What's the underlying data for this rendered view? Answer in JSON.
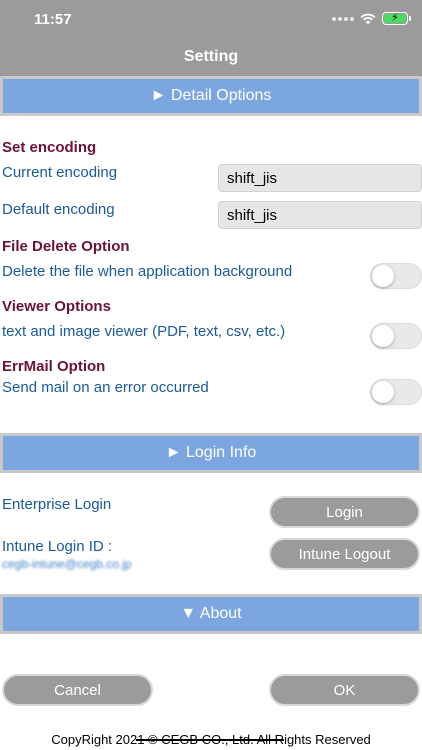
{
  "status_bar": {
    "time": "11:57"
  },
  "nav": {
    "title": "Setting"
  },
  "sections": {
    "detail": "► Detail Options",
    "login": "► Login Info",
    "about": "▼ About"
  },
  "encoding": {
    "heading": "Set encoding",
    "current_label": "Current encoding",
    "current_value": "shift_jis",
    "default_label": "Default encoding",
    "default_value": "shift_jis"
  },
  "file_delete": {
    "heading": "File Delete Option",
    "label": "Delete the file when application background",
    "enabled": false
  },
  "viewer": {
    "heading": "Viewer Options",
    "label": "text and image viewer (PDF, text, csv, etc.)",
    "enabled": false
  },
  "errmail": {
    "heading": "ErrMail Option",
    "label": "Send mail on an error occurred",
    "enabled": false
  },
  "login": {
    "enterprise_label": "Enterprise Login",
    "login_button": "Login",
    "intune_label": "Intune Login ID :",
    "intune_id": "cegb-intune@cegb.co.jp",
    "intune_logout_button": "Intune Logout"
  },
  "footer": {
    "cancel": "Cancel",
    "ok": "OK",
    "copyright": "CopyRight 2021 © CEGB CO., Ltd. All Rights Reserved"
  },
  "colors": {
    "nav_bg": "#9b9b9b",
    "section_bar": "#7ba6e0",
    "heading": "#6a1238",
    "label": "#1a5a9a",
    "button_bg": "#9b9b9b",
    "battery": "#4cd964"
  },
  "icons": [
    "signal-dots-icon",
    "wifi-icon",
    "battery-charging-icon"
  ]
}
